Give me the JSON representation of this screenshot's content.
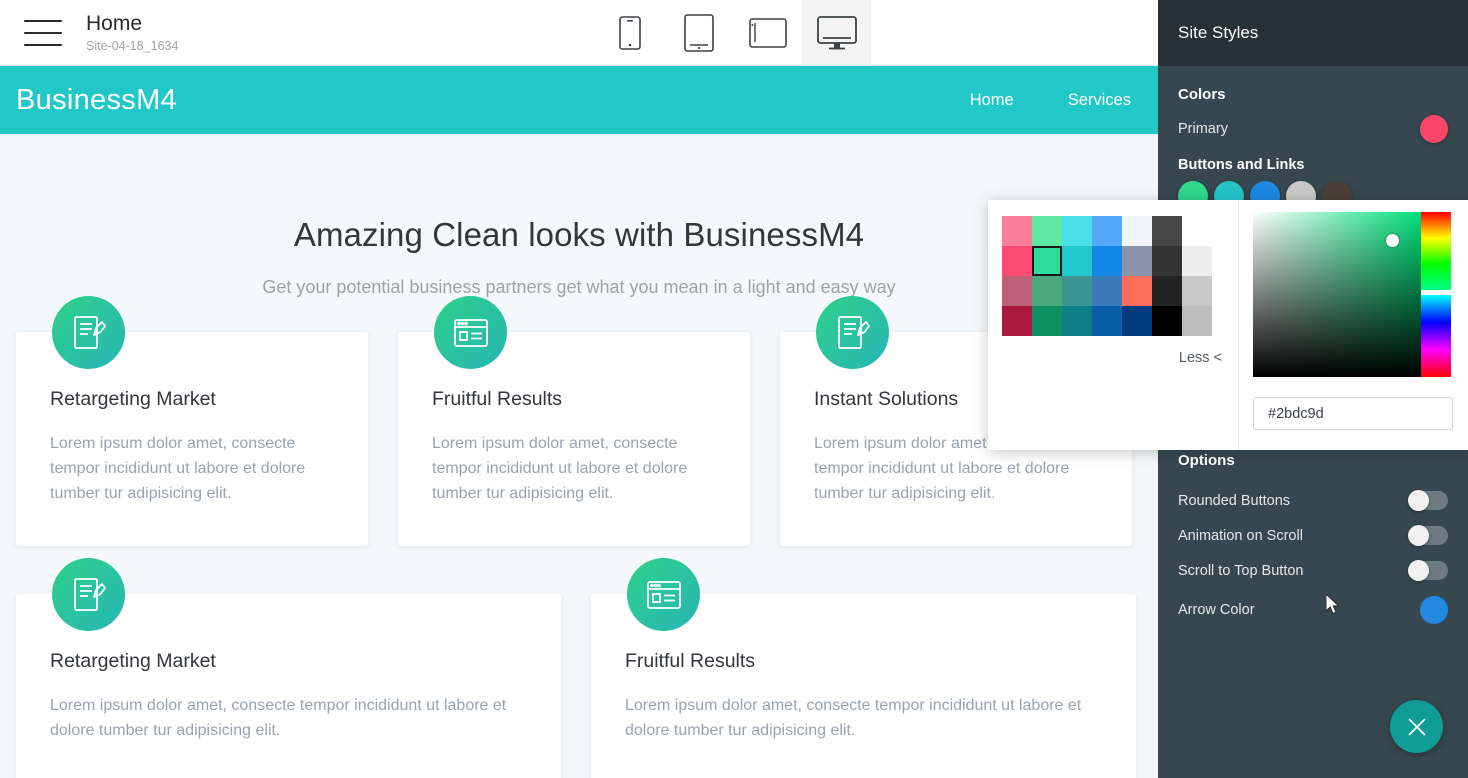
{
  "editor": {
    "menu_icon": "hamburger-icon",
    "page_title": "Home",
    "site_name": "Site-04-18_1634",
    "devices": [
      {
        "name": "mobile",
        "icon": "phone-icon",
        "active": false
      },
      {
        "name": "tablet-portrait",
        "icon": "tablet-icon",
        "active": false
      },
      {
        "name": "tablet-landscape",
        "icon": "tablet-landscape-icon",
        "active": false
      },
      {
        "name": "desktop",
        "icon": "monitor-icon",
        "active": true
      }
    ]
  },
  "preview": {
    "nav": {
      "brand": "BusinessM4",
      "links": [
        "Home",
        "Services"
      ],
      "bg_color": "#22c8c8"
    },
    "hero": {
      "heading": "Amazing Clean looks with BusinessM4",
      "subheading": "Get your potential business partners get what you mean in a light and easy way"
    },
    "cards_row1": [
      {
        "icon": "note-edit-icon",
        "title": "Retargeting Market",
        "body": "Lorem ipsum dolor amet, consecte tempor incididunt ut labore et dolore tumber tur adipisicing elit."
      },
      {
        "icon": "browser-window-icon",
        "title": "Fruitful Results",
        "body": "Lorem ipsum dolor amet, consecte tempor incididunt ut labore et dolore tumber tur adipisicing elit."
      },
      {
        "icon": "note-edit-icon",
        "title": "Instant Solutions",
        "body": "Lorem ipsum dolor amet, consecte tempor incididunt ut labore et dolore tumber tur adipisicing elit."
      }
    ],
    "cards_row2": [
      {
        "icon": "note-edit-icon",
        "title": "Retargeting Market",
        "body": "Lorem ipsum dolor amet, consecte tempor incididunt ut labore et dolore tumber tur adipisicing elit."
      },
      {
        "icon": "browser-window-icon",
        "title": "Fruitful Results",
        "body": "Lorem ipsum dolor amet, consecte tempor incididunt ut labore et dolore tumber tur adipisicing elit."
      }
    ]
  },
  "panel": {
    "title": "Site Styles",
    "colors_title": "Colors",
    "primary_label": "Primary",
    "primary_color": "#f94668",
    "buttons_label": "Buttons and Links",
    "button_colors": [
      "#2fd98e",
      "#25c3c7",
      "#1e88e5",
      "#c9c9c9",
      "#4a4038"
    ],
    "options_title": "Options",
    "options": [
      {
        "label": "Rounded Buttons",
        "on": false
      },
      {
        "label": "Animation on Scroll",
        "on": false
      },
      {
        "label": "Scroll to Top Button",
        "on": false
      }
    ],
    "arrow_color_label": "Arrow Color",
    "arrow_color": "#2288e0",
    "close_icon": "close-icon",
    "close_button_color": "#109c96"
  },
  "picker": {
    "swatches": [
      "#fb7f9b",
      "#5ee8a4",
      "#4ae0e8",
      "#55a8f5",
      "#f2f6f8",
      "#454545",
      "#ffffff",
      "#fb4a74",
      "#2bdc9d",
      "#21c9cd",
      "#1488e8",
      "#8b94ab",
      "#343434",
      "#eeeeee",
      "#bc6078",
      "#4aa87c",
      "#3d9494",
      "#3b79bb",
      "#fc6e59",
      "#232323",
      "#c9c9c9",
      "#ab1a3e",
      "#0e9060",
      "#0d7f86",
      "#0a5ea8",
      "#023c7e",
      "#000000",
      "#bdbdbd"
    ],
    "selected_index": 8,
    "less_label": "Less <",
    "hex_value": "#2bdc9d"
  }
}
